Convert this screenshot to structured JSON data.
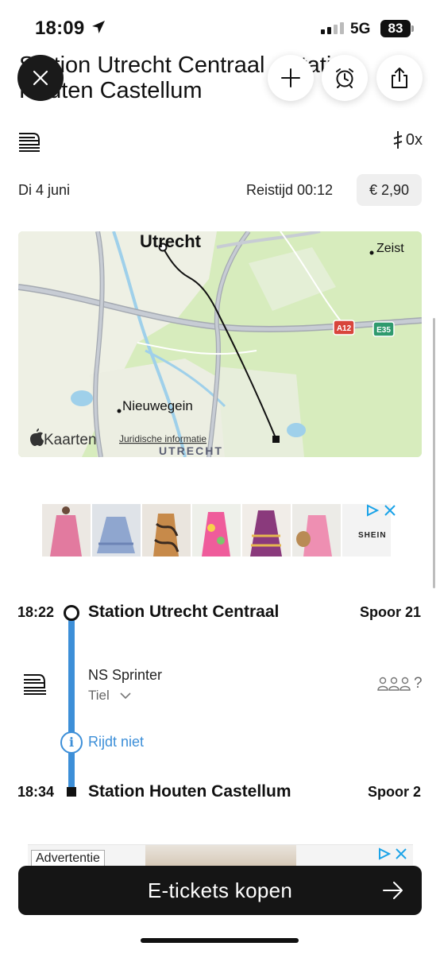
{
  "status_bar": {
    "time": "18:09",
    "network": "5G",
    "battery": "83"
  },
  "header": {
    "title": "Station Utrecht Centraal - Station Houten Castellum",
    "transfers": "0x"
  },
  "trip": {
    "date": "Di 4 juni",
    "duration": "Reistijd 00:12",
    "price": "€ 2,90"
  },
  "map": {
    "labels": {
      "city_main": "Utrecht",
      "city_zeist": "Zeist",
      "city_nieuwegein": "Nieuwegein",
      "road_a12": "A12",
      "road_e35": "E35",
      "region": "UTRECHT"
    },
    "attribution_brand": "Kaarten",
    "legal_link": "Juridische informatie"
  },
  "ad_top": {
    "brand": "SHEIN"
  },
  "journey": {
    "departure": {
      "time": "18:22",
      "station": "Station Utrecht Centraal",
      "platform": "Spoor 21"
    },
    "service": {
      "name": "NS Sprinter",
      "direction": "Tiel"
    },
    "crowd_indicator": "?",
    "notice": "Rijdt niet",
    "arrival": {
      "time": "18:34",
      "station": "Station Houten Castellum",
      "platform": "Spoor 2"
    }
  },
  "ad_bottom": {
    "label": "Advertentie"
  },
  "cta": {
    "label": "E-tickets kopen"
  },
  "colors": {
    "accent_blue": "#3d8fd8",
    "cta_bg": "#151515",
    "map_green": "#d7ecbd"
  }
}
